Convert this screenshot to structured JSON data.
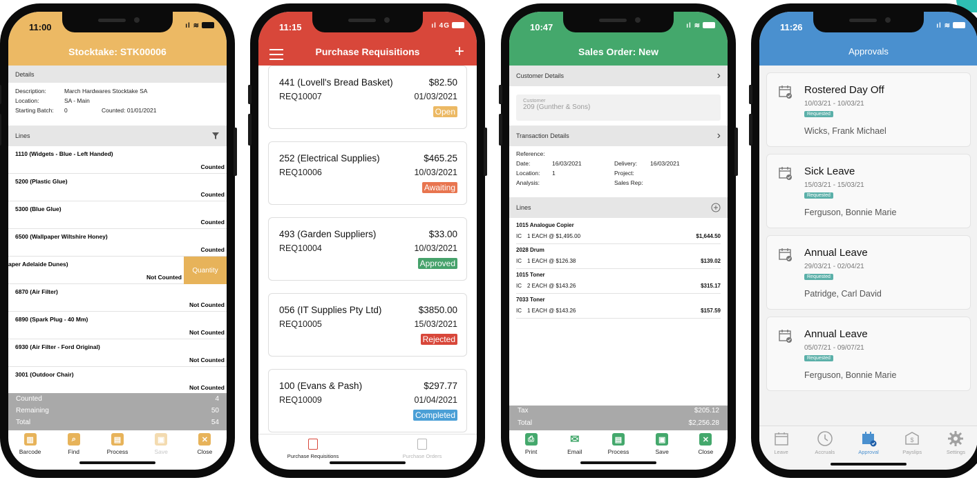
{
  "stocktake": {
    "time": "11:00",
    "title": "Stocktake: STK00006",
    "details_header": "Details",
    "description_label": "Description:",
    "description_value": "March Hardwares Stocktake SA",
    "location_label": "Location:",
    "location_value": "SA - Main",
    "batch_label": "Starting Batch:",
    "batch_value": "0",
    "counted_label": "Counted:",
    "counted_value": "01/01/2021",
    "lines_header": "Lines",
    "lines": [
      {
        "name": "1110 (Widgets - Blue - Left Handed)",
        "status": "Counted"
      },
      {
        "name": "5200 (Plastic Glue)",
        "status": "Counted"
      },
      {
        "name": "5300 (Blue Glue)",
        "status": "Counted"
      },
      {
        "name": "6500 (Wallpaper Wiltshire Honey)",
        "status": "Counted"
      },
      {
        "name": "aper Adelaide Dunes)",
        "status": "Not Counted",
        "action": "Quantity"
      },
      {
        "name": "6870 (Air Filter)",
        "status": "Not Counted"
      },
      {
        "name": "6890 (Spark Plug - 40 Mm)",
        "status": "Not Counted"
      },
      {
        "name": "6930 (Air Filter - Ford Original)",
        "status": "Not Counted"
      },
      {
        "name": "3001 (Outdoor Chair)",
        "status": "Not Counted"
      }
    ],
    "totals": [
      {
        "label": "Counted",
        "value": "4"
      },
      {
        "label": "Remaining",
        "value": "50"
      },
      {
        "label": "Total",
        "value": "54"
      }
    ],
    "tabs": [
      {
        "label": "Barcode",
        "icon": "barcode-icon",
        "color": "#e7b35a"
      },
      {
        "label": "Find",
        "icon": "find-icon",
        "color": "#e7b35a"
      },
      {
        "label": "Process",
        "icon": "process-icon",
        "color": "#e7b35a"
      },
      {
        "label": "Save",
        "icon": "save-icon",
        "color": "#f3dbb0"
      },
      {
        "label": "Close",
        "icon": "close-icon",
        "color": "#e7b35a"
      }
    ]
  },
  "requisitions": {
    "time": "11:15",
    "network": "4G",
    "title": "Purchase Requisitions",
    "cards": [
      {
        "name": "441 (Lovell's Bread Basket)",
        "amount": "$82.50",
        "req": "REQ10007",
        "date": "01/03/2021",
        "status": "Open",
        "color": "#ecb964"
      },
      {
        "name": "252 (Electrical Supplies)",
        "amount": "$465.25",
        "req": "REQ10006",
        "date": "10/03/2021",
        "status": "Awaiting",
        "color": "#e8754f"
      },
      {
        "name": "493 (Garden Suppliers)",
        "amount": "$33.00",
        "req": "REQ10004",
        "date": "10/03/2021",
        "status": "Approved",
        "color": "#46a26b"
      },
      {
        "name": "056 (IT Supplies Pty Ltd)",
        "amount": "$3850.00",
        "req": "REQ10005",
        "date": "15/03/2021",
        "status": "Rejected",
        "color": "#d8473a"
      },
      {
        "name": "100 (Evans & Pash)",
        "amount": "$297.77",
        "req": "REQ10009",
        "date": "01/04/2021",
        "status": "Completed",
        "color": "#4a9fd6"
      }
    ],
    "tabs": [
      {
        "label": "Purchase Requisitions",
        "active": true
      },
      {
        "label": "Purchase Orders",
        "active": false
      }
    ]
  },
  "sales_order": {
    "time": "10:47",
    "title": "Sales Order: New",
    "customer_header": "Customer Details",
    "customer_label": "Customer",
    "customer_value": "209 (Gunther & Sons)",
    "transaction_header": "Transaction Details",
    "reference_label": "Reference:",
    "date_label": "Date:",
    "date_value": "16/03/2021",
    "delivery_label": "Delivery:",
    "delivery_value": "16/03/2021",
    "location_label": "Location:",
    "location_value": "1",
    "project_label": "Project:",
    "analysis_label": "Analysis:",
    "salesrep_label": "Sales Rep:",
    "lines_header": "Lines",
    "lines": [
      {
        "name": "1015 Analogue Copier",
        "code": "IC",
        "qty": "1 EACH @ $1,495.00",
        "total": "$1,644.50"
      },
      {
        "name": "2028 Drum",
        "code": "IC",
        "qty": "1 EACH @ $126.38",
        "total": "$139.02"
      },
      {
        "name": "1015 Toner",
        "code": "IC",
        "qty": "2 EACH @ $143.26",
        "total": "$315.17"
      },
      {
        "name": "7033 Toner",
        "code": "IC",
        "qty": "1 EACH @ $143.26",
        "total": "$157.59"
      }
    ],
    "totals": [
      {
        "label": "Tax",
        "value": "$205.12"
      },
      {
        "label": "Total",
        "value": "$2,256.28"
      }
    ],
    "tabs": [
      {
        "label": "Print",
        "icon": "print-icon"
      },
      {
        "label": "Email",
        "icon": "email-icon"
      },
      {
        "label": "Process",
        "icon": "process-icon"
      },
      {
        "label": "Save",
        "icon": "save-icon"
      },
      {
        "label": "Close",
        "icon": "close-icon"
      }
    ]
  },
  "approvals": {
    "time": "11:26",
    "title": "Approvals",
    "items": [
      {
        "type": "Rostered Day Off",
        "range": "10/03/21 - 10/03/21",
        "status": "Requested",
        "person": "Wicks, Frank Michael"
      },
      {
        "type": "Sick Leave",
        "range": "15/03/21 - 15/03/21",
        "status": "Requested",
        "person": "Ferguson, Bonnie Marie"
      },
      {
        "type": "Annual Leave",
        "range": "29/03/21 - 02/04/21",
        "status": "Requested",
        "person": "Patridge, Carl David"
      },
      {
        "type": "Annual Leave",
        "range": "05/07/21 - 09/07/21",
        "status": "Requested",
        "person": "Ferguson, Bonnie Marie"
      }
    ],
    "tabs": [
      {
        "label": "Leave",
        "icon": "calendar-icon",
        "active": false
      },
      {
        "label": "Accruals",
        "icon": "clock-icon",
        "active": false
      },
      {
        "label": "Approval",
        "icon": "approval-calendar-icon",
        "active": true
      },
      {
        "label": "Payslips",
        "icon": "payslip-icon",
        "active": false
      },
      {
        "label": "Settings",
        "icon": "gear-icon",
        "active": false
      }
    ]
  },
  "colors": {
    "stocktake": "#ecb964",
    "requisitions": "#d8473a",
    "sales": "#44a86c",
    "approvals": "#4a90cf",
    "accent_teal": "#2fbfb3"
  }
}
